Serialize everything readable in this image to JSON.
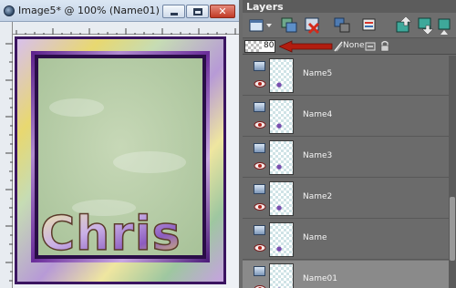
{
  "image_window": {
    "title": "Image5* @ 100% (Name01)",
    "artwork_text": "Chris",
    "colors": {
      "frame_purple": "#6a2d9a",
      "mat_green": "#b9cfa8",
      "gold": "#e2cb52"
    }
  },
  "layers_palette": {
    "title": "Layers",
    "opacity": "80",
    "blend_mode": "None",
    "rows": [
      {
        "name": "Name5"
      },
      {
        "name": "Name4"
      },
      {
        "name": "Name3"
      },
      {
        "name": "Name2"
      },
      {
        "name": "Name"
      },
      {
        "name": "Name01",
        "selected": true
      }
    ]
  },
  "icons": [
    "app-icon",
    "minimize-icon",
    "maximize-icon",
    "close-icon",
    "new-layer-icon",
    "duplicate-layer-icon",
    "delete-layer-icon",
    "merge-layer-icon",
    "layer-properties-icon",
    "move-layer-up-icon",
    "move-layer-down-icon",
    "visibility-icon",
    "lock-icon",
    "link-icon"
  ]
}
